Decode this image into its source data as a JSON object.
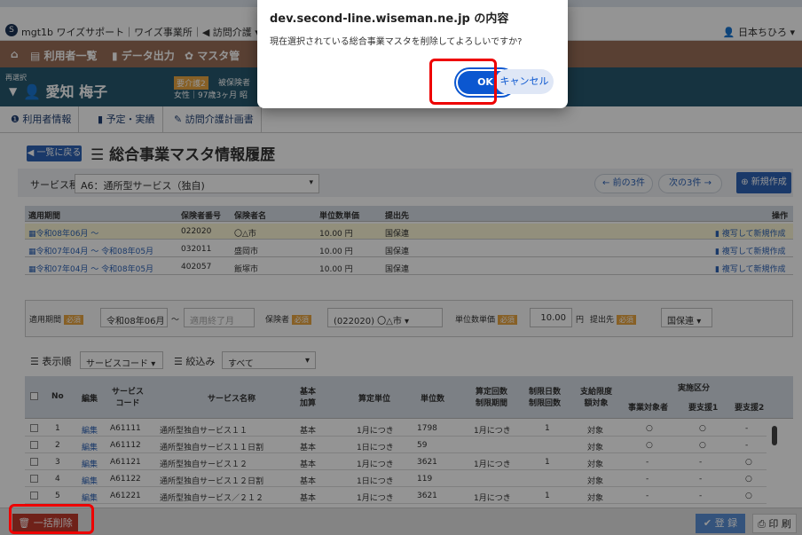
{
  "app": {
    "title": "mgt1b ワイズサポート｜ワイズ事業所｜◀ 訪問介護 ▾",
    "user": "日本ちひろ ▾",
    "logo": "S"
  },
  "nav": {
    "items": [
      "利用者一覧",
      "データ出力",
      "マスタ管"
    ]
  },
  "patient": {
    "change_label": "再選択",
    "name": "愛知 梅子",
    "care_level": "要介護2",
    "insurance": "被保険者",
    "info": "女性｜97歳3ヶ月 昭"
  },
  "subtabs": [
    "利用者情報",
    "予定・実績",
    "訪問介護計画書"
  ],
  "header": {
    "back_button": "一覧に戻る",
    "title": "総合事業マスタ情報履歴"
  },
  "filter": {
    "service_type_label": "サービス種類",
    "service_type_value": "A6：通所型サービス（独自)",
    "prev_button": "← 前の3件",
    "next_button": "次の3件 →",
    "new_button": "新規作成"
  },
  "history_table": {
    "headers": [
      "適用期間",
      "保険者番号",
      "保険者名",
      "単位数単価",
      "提出先",
      "操作"
    ],
    "rows": [
      {
        "period": "令和08年06月 ～",
        "insurer_no": "022020",
        "insurer_name": "〇△市",
        "unit_price": "10.00 円",
        "submit_to": "国保連",
        "op": "複写して新規作成"
      },
      {
        "period": "令和07年04月 ～ 令和08年05月",
        "insurer_no": "032011",
        "insurer_name": "盛岡市",
        "unit_price": "10.00 円",
        "submit_to": "国保連",
        "op": "複写して新規作成"
      },
      {
        "period": "令和07年04月 ～ 令和08年05月",
        "insurer_no": "402057",
        "insurer_name": "飯塚市",
        "unit_price": "10.00 円",
        "submit_to": "国保連",
        "op": "複写して新規作成"
      }
    ]
  },
  "form": {
    "period_label": "適用期間",
    "required": "必須",
    "start_value": "令和08年06月",
    "tilde": "～",
    "end_placeholder": "適用終了月",
    "insurer_label": "保険者",
    "insurer_value": "(022020) 〇△市",
    "unit_price_label": "単位数単価",
    "unit_price_value": "10.00",
    "yen": "円",
    "submit_label": "提出先",
    "submit_value": "国保連"
  },
  "sort": {
    "order_label": "表示順",
    "order_value": "サービスコード",
    "filter_label": "絞込み",
    "filter_value": "すべて"
  },
  "service_table": {
    "headers": {
      "no": "No",
      "edit": "編集",
      "code": "サービス\nコード",
      "name": "サービス名称",
      "basic": "基本\n加算",
      "calc_unit": "算定単位",
      "units": "単位数",
      "calc_count": "算定回数\n制限期間",
      "limit_days": "制限日数\n制限回数",
      "limit_target": "支給限度\n額対象",
      "impl_group": "実施区分",
      "impl1": "事業対象者",
      "impl2": "要支援1",
      "impl3": "要支援2"
    },
    "rows": [
      {
        "no": "1",
        "edit": "編集",
        "code": "A61111",
        "name": "通所型独自サービス１１",
        "basic": "基本",
        "calc_unit": "1月につき",
        "units": "1798",
        "calc_count": "1月につき",
        "limit_days": "1",
        "limit_target": "対象",
        "i1": "○",
        "i2": "○",
        "i3": "-"
      },
      {
        "no": "2",
        "edit": "編集",
        "code": "A61112",
        "name": "通所型独自サービス１１日割",
        "basic": "基本",
        "calc_unit": "1日につき",
        "units": "59",
        "calc_count": "",
        "limit_days": "",
        "limit_target": "対象",
        "i1": "○",
        "i2": "○",
        "i3": "-"
      },
      {
        "no": "3",
        "edit": "編集",
        "code": "A61121",
        "name": "通所型独自サービス１２",
        "basic": "基本",
        "calc_unit": "1月につき",
        "units": "3621",
        "calc_count": "1月につき",
        "limit_days": "1",
        "limit_target": "対象",
        "i1": "-",
        "i2": "-",
        "i3": "○"
      },
      {
        "no": "4",
        "edit": "編集",
        "code": "A61122",
        "name": "通所型独自サービス１２日割",
        "basic": "基本",
        "calc_unit": "1日につき",
        "units": "119",
        "calc_count": "",
        "limit_days": "",
        "limit_target": "対象",
        "i1": "-",
        "i2": "-",
        "i3": "○"
      },
      {
        "no": "5",
        "edit": "編集",
        "code": "A61221",
        "name": "通所型独自サービス／２１２",
        "basic": "基本",
        "calc_unit": "1月につき",
        "units": "3621",
        "calc_count": "1月につき",
        "limit_days": "1",
        "limit_target": "対象",
        "i1": "-",
        "i2": "-",
        "i3": "○"
      }
    ]
  },
  "footer": {
    "bulk_delete": "一括削除",
    "save": "登 録",
    "print": "印 刷"
  },
  "dialog": {
    "title": "dev.second-line.wiseman.ne.jp の内容",
    "message": "現在選択されている総合事業マスタを削除してよろしいですか?",
    "ok": "OK",
    "cancel": "キャンセル"
  },
  "colors": {
    "nav": "#9a6e58",
    "patient_bar": "#26586f",
    "primary": "#2e63b6",
    "dialog_ok": "#0b57d0",
    "highlight": "#ee0000",
    "danger": "#c0392b"
  }
}
